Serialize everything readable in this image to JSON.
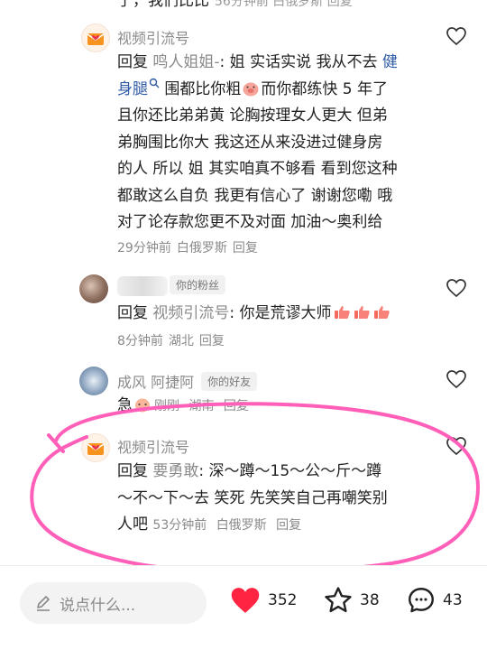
{
  "top_partial": {
    "text": "了，我们比比",
    "meta": "56分钟前 白俄罗斯 回复"
  },
  "comments": [
    {
      "author": "视频引流号",
      "reply_prefix": "回复",
      "reply_to": "鸣人姐姐-",
      "parts": {
        "line1_text": ": 姐 实话实说 我从不去 ",
        "link1": "健",
        "link2": "身腿",
        "line2_text": " 围都比你粗",
        "line2_text_b": "而你都练快 5 年了",
        "line3": "且你还比弟弟黄 论胸按理女人更大 但弟",
        "line4": "弟胸围比你大 我这还从来没进过健身房",
        "line5": "的人 所以 姐 其实咱真不够看 看到您这种",
        "line6": "都敢这么自负 我更有信心了 谢谢您嘞 哦",
        "line7": "对了论存款您更不及对面 加油～奥利给"
      },
      "time": "29分钟前",
      "location": "白俄罗斯",
      "reply_label": "回复"
    },
    {
      "author_tag": "你的粉丝",
      "reply_prefix": "回复",
      "reply_to": "视频引流号",
      "text": ": 你是荒谬大师",
      "time": "8分钟前",
      "location": "湖北",
      "reply_label": "回复"
    },
    {
      "author": "成风 阿捷阿",
      "author_tag": "你的好友",
      "text": "急",
      "time": "刚刚",
      "location": "湖南",
      "reply_label": "回复"
    },
    {
      "author": "视频引流号",
      "reply_prefix": "回复",
      "reply_to": "要勇敢",
      "line1": ": 深～蹲～15～公～斤～蹲",
      "line2": "～不～下～去 笑死 先笑笑自己再嘲笑别",
      "line3": "人吧",
      "time": "53分钟前",
      "location": "白俄罗斯",
      "reply_label": "回复"
    }
  ],
  "bottom_bar": {
    "input_placeholder": "说点什么...",
    "likes": "352",
    "favorites": "38",
    "comments": "43"
  },
  "colors": {
    "like_red": "#ff2442",
    "annotation_pink": "#ff5fb8",
    "link_blue": "#2e5aa6",
    "meta_gray": "#8a8a8a"
  }
}
